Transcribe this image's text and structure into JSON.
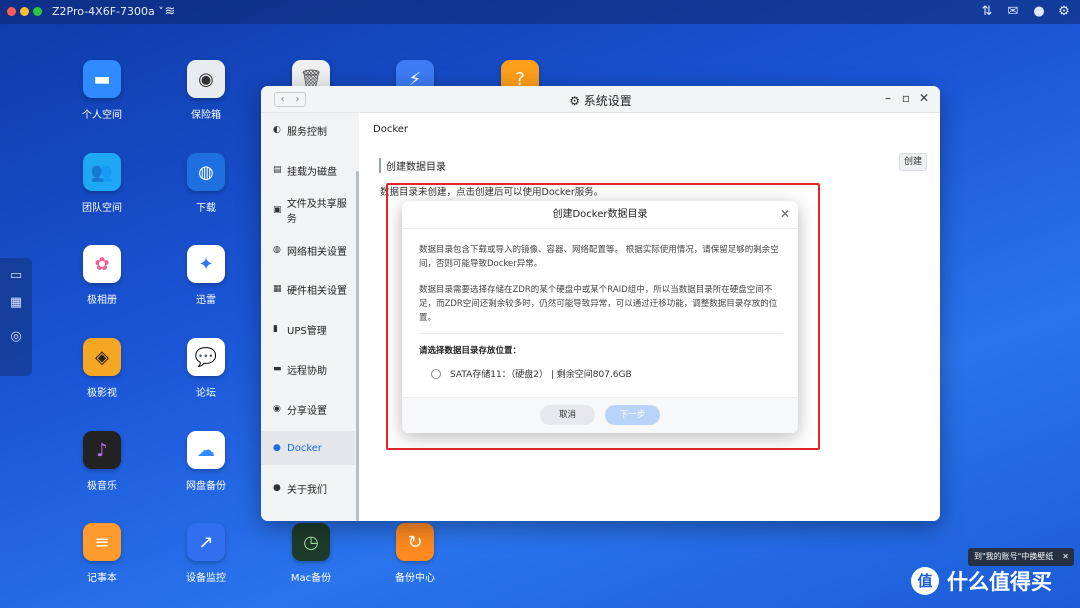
{
  "topbar": {
    "hostname": "Z2Pro-4X6F-7300a ˅"
  },
  "desktop_apps": [
    {
      "label": "个人空间"
    },
    {
      "label": "保险箱"
    },
    {
      "label": "团队空间"
    },
    {
      "label": "下载"
    },
    {
      "label": "极相册"
    },
    {
      "label": "迅雷"
    },
    {
      "label": "极影视"
    },
    {
      "label": "论坛"
    },
    {
      "label": "极音乐"
    },
    {
      "label": "网盘备份"
    },
    {
      "label": "记事本"
    },
    {
      "label": "设备监控"
    },
    {
      "label": "Mac备份"
    },
    {
      "label": "备份中心"
    }
  ],
  "window": {
    "title": "系统设置",
    "sidebar": [
      {
        "label": "服务控制"
      },
      {
        "label": "挂载为磁盘"
      },
      {
        "label": "文件及共享服务"
      },
      {
        "label": "网络相关设置"
      },
      {
        "label": "硬件相关设置"
      },
      {
        "label": "UPS管理"
      },
      {
        "label": "远程协助"
      },
      {
        "label": "分享设置"
      },
      {
        "label": "Docker"
      },
      {
        "label": "关于我们"
      }
    ],
    "content": {
      "breadcrumb": "Docker",
      "section_title": "创建数据目录",
      "create_button": "创建",
      "description": "数据目录未创建，点击创建后可以使用Docker服务。"
    }
  },
  "modal": {
    "title": "创建Docker数据目录",
    "para1_line1": "数据目录包含下载或导入的镜像、容器、网络配置等。 根据实际使用情况，请保留足够的剩余空",
    "para1_line2": "间，否则可能导致Docker异常。",
    "para2_line1": "数据目录需要选择存储在ZDR的某个硬盘中或某个RAID组中，所以当数据目录所在硬盘空间不",
    "para2_line2": "足，而ZDR空间还剩余较多时，仍然可能导致异常，可以通过迁移功能，调整数据目录存放的位",
    "para2_line3": "置。",
    "select_label": "请选择数据目录存放位置：",
    "option": "SATA存储11：（硬盘2） | 剩余空间807.6GB",
    "cancel": "取消",
    "next": "下一步"
  },
  "tooltip": {
    "text": "到\"我的账号\"中换壁纸",
    "close": "✕"
  },
  "watermark": {
    "text": "什么值得买",
    "logo": "值"
  }
}
